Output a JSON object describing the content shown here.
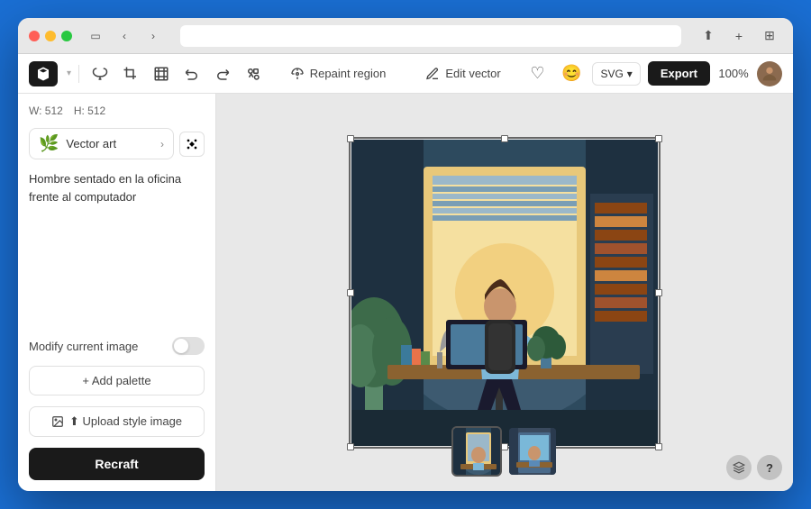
{
  "window": {
    "traffic_lights": [
      "red",
      "yellow",
      "green"
    ],
    "nav_back": "‹",
    "nav_forward": "›",
    "url_placeholder": ""
  },
  "toolbar": {
    "logo_alt": "Recraft logo",
    "tools": [
      "lasso",
      "crop",
      "undo",
      "redo",
      "frame"
    ],
    "repaint_region_label": "Repaint region",
    "edit_vector_label": "Edit vector",
    "svg_label": "SVG",
    "export_label": "Export",
    "zoom_value": "100%"
  },
  "sidebar": {
    "width_label": "W: 512",
    "height_label": "H: 512",
    "style_icon": "🌿",
    "style_name": "Vector art",
    "style_arrow": "›",
    "prompt_text": "Hombre sentado en la oficina frente al computador",
    "modify_label": "Modify current image",
    "add_palette_label": "+ Add palette",
    "upload_label": "⬆ Upload style image",
    "recraft_label": "Recraft"
  },
  "thumbnails": [
    {
      "id": 1,
      "active": true
    },
    {
      "id": 2,
      "active": false
    }
  ],
  "bottom_icons": {
    "layers_icon": "◑",
    "help_icon": "?"
  }
}
